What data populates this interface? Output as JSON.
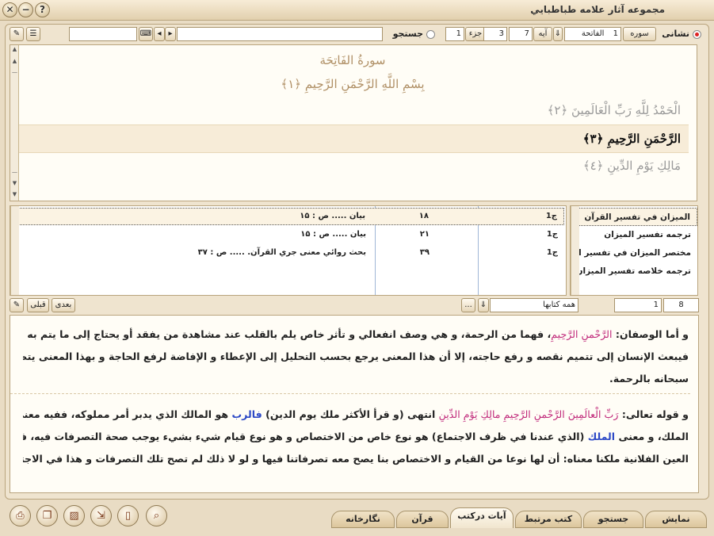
{
  "window": {
    "title": "مجموعه آثار علامه طباطبايي"
  },
  "toolbar": {
    "display_label": "نشانی",
    "surah_label": "سوره",
    "surah_number": "1",
    "surah_name": "الفاتحة",
    "ayah_label": "آيه",
    "ayah_value": "7",
    "ayah_value2": "3",
    "juz_label": "جزء",
    "juz_value": "1",
    "search_label": "جستجو"
  },
  "quran": {
    "surah_title": "سورةُ الفَاتِحَة",
    "basmala": "بِسْمِ اللَّهِ الرَّحْمَنِ الرَّحِيمِ ﴿١﴾",
    "verses": [
      "الْحَمْدُ لِلَّهِ رَبِّ الْعَالَمِينَ ﴿٢﴾",
      "الرَّحْمَنِ الرَّحِيمِ ﴿٣﴾",
      "مَالِكِ يَوْمِ الدِّينِ ﴿٤﴾"
    ]
  },
  "books": [
    "الميزان في تفسير القرآن",
    "ترجمه تفسير الميزان",
    "مختصر الميزان في تفسير ال ...",
    "ترجمه خلاصه تفسير الميزان"
  ],
  "refs": [
    {
      "vol": "ج1",
      "page": "۱۸",
      "desc": "بيان ..... ص : ۱۵"
    },
    {
      "vol": "ج1",
      "page": "۲۱",
      "desc": "بيان ..... ص : ۱۵"
    },
    {
      "vol": "ج1",
      "page": "۳۹",
      "desc": "بحث روائي معنى جري القرآن. ..... ص : ۳۷"
    }
  ],
  "midbar": {
    "books_page": "8",
    "page_value": "1",
    "all_books": "همه کتابها",
    "ellipsis": "...",
    "next_label": "بعدی",
    "prev_label": "قبلی"
  },
  "text": {
    "l1a": "و أما الوصفان: ",
    "l1q": "الرَّحْمنِ الرَّحِيمِ",
    "l1b": "، فهما من الرحمة، و هي وصف انفعالي و تأثر خاص يلم بالقلب عند مشاهدة من يفقد أو يحتاج إلى ما يتم به أمره",
    "l2": "فيبعث الإنسان إلى تتميم نقصه و رفع حاجته، إلا أن هذا المعنى يرجع بحسب التحليل إلى الإعطاء و الإفاضة لرفع الحاجة و بهذا المعنى يتصف",
    "l3": "سبحانه بالرحمة.",
    "l4a": "و قوله تعالى: ",
    "l4q1": "رَبِّ الْعالَمِينَ الرَّحْمنِ الرَّحِيمِ مالِكِ يَوْمِ الدِّينِ",
    "l4b": " انتهى (و قرأ الأكثر ملك يوم الدين) ",
    "l4c": "فالرب",
    "l4d": " هو المالك الذي يدبر أمر مملوكه، ففيه معنى",
    "l5a": "الملك، و معنى ",
    "l5b": "الملك",
    "l5c": " (الذي عندنا في ظرف الاجتماع) هو نوع خاص من الاختصاص و هو نوع قيام شيء بشيء يوجب صحة التصرفات فيه، فقولنا",
    "l6": "العين الفلانية ملكنا معناه: أن لها نوعا من القيام و الاختصاص بنا يصح معه تصرفاتنا فيها و لو لا ذلك لم تصح تلك التصرفات و هذا في الاجتماع"
  },
  "tabs": [
    "نمایش",
    "جستجو",
    "کتب مرتبط",
    "آيات درکتب",
    "قرآن",
    "نگارخانه"
  ],
  "icons": {
    "close": "close-icon",
    "minimize": "minimize-icon",
    "help": "help-icon",
    "search": "magnifier-icon",
    "print": "print-icon"
  }
}
